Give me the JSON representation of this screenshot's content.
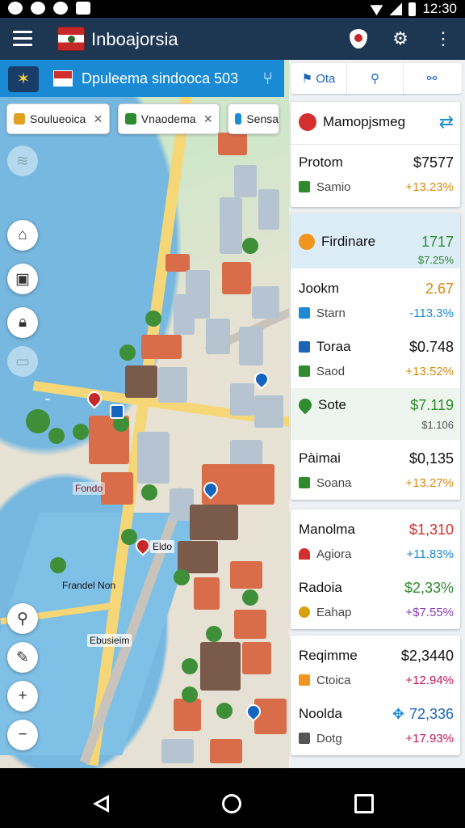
{
  "status": {
    "time": "12:30"
  },
  "app": {
    "title": "Inboajorsia"
  },
  "search_strip": {
    "text": "Dpuleema sindooca 503",
    "menu_icon": "compass-icon",
    "locate_icon": "fork-icon"
  },
  "chips": [
    {
      "label": "Soulueoica",
      "icon_color": "#e0a020"
    },
    {
      "label": "Vnaodema",
      "icon_color": "#2e8b2e"
    },
    {
      "label": "Sensa",
      "icon_color": "#1c8ad4"
    }
  ],
  "map_labels": {
    "label_a": "",
    "label_b": "Eldo",
    "label_c": "Fondo",
    "label_d": "Frandel Non",
    "label_e": "Ebusieim"
  },
  "panel": {
    "toolbar": {
      "filter_label": "Ota"
    },
    "header": {
      "title": "Mamopjsmeg"
    },
    "rows": [
      {
        "name": "Protom",
        "value": "$7577",
        "sub": "Samio",
        "change": "+13.23%",
        "change_color": "#d68a10",
        "icon_color": "#2e8b2e"
      },
      {
        "name": "Firdinare",
        "value": "1717",
        "sub": "",
        "change": "$7.25%",
        "change_color": "#2e8b2e",
        "icon_color": "#f0961e"
      },
      {
        "name": "Jookm",
        "value": "2.67",
        "sub": "Starn",
        "change": "-113.3%",
        "change_color": "#1c8ad4",
        "icon_color": "#1c8ad4"
      },
      {
        "name": "Toraa",
        "value": "$0.748",
        "sub": "Saod",
        "change": "+13.52%",
        "change_color": "#d68a10",
        "icon_color": "#2e8b2e"
      },
      {
        "name": "Sote",
        "value": "$7.119",
        "sub": "",
        "change": "$1.106",
        "change_color": "#555555",
        "icon_color": "#2e8b2e"
      },
      {
        "name": "Pàimai",
        "value": "$0,135",
        "sub": "Soana",
        "change": "+13.27%",
        "change_color": "#d68a10",
        "icon_color": "#2e8b2e"
      },
      {
        "name": "Manolma",
        "value": "$1,310",
        "sub": "Agiora",
        "change": "+11.83%",
        "change_color": "#1c8ad4",
        "icon_color": "#d32f2f"
      },
      {
        "name": "Radoia",
        "value": "$2,33%",
        "sub": "Eahap",
        "change": "+$7.55%",
        "change_color": "#8a3fb0",
        "icon_color": "#d6a010"
      },
      {
        "name": "Reqimme",
        "value": "$2,3440",
        "sub": "Ctoica",
        "change": "+12.94%",
        "change_color": "#c2185b",
        "icon_color": "#f0961e"
      },
      {
        "name": "Noolda",
        "value": "72,336",
        "sub": "Dotg",
        "change": "+17.93%",
        "change_color": "#c2185b",
        "icon_color": "#555555"
      }
    ]
  }
}
